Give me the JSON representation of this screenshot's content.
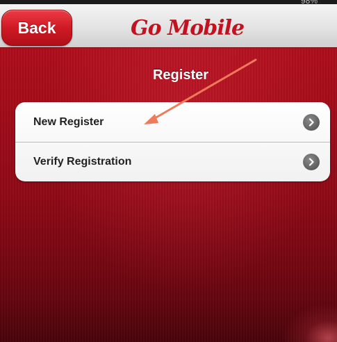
{
  "status_bar": {
    "text": "98%"
  },
  "navbar": {
    "back_label": "Back",
    "logo_text": "Go Mobile"
  },
  "page": {
    "title": "Register"
  },
  "menu": {
    "items": [
      {
        "label": "New Register",
        "icon": "chevron-right-circle-icon"
      },
      {
        "label": "Verify Registration",
        "icon": "chevron-right-circle-icon"
      }
    ]
  },
  "colors": {
    "background_red": "#a50c1a",
    "back_button_red": "#cf1a25",
    "logo_red": "#c2121f",
    "annotation_arrow": "#f07a5a"
  }
}
